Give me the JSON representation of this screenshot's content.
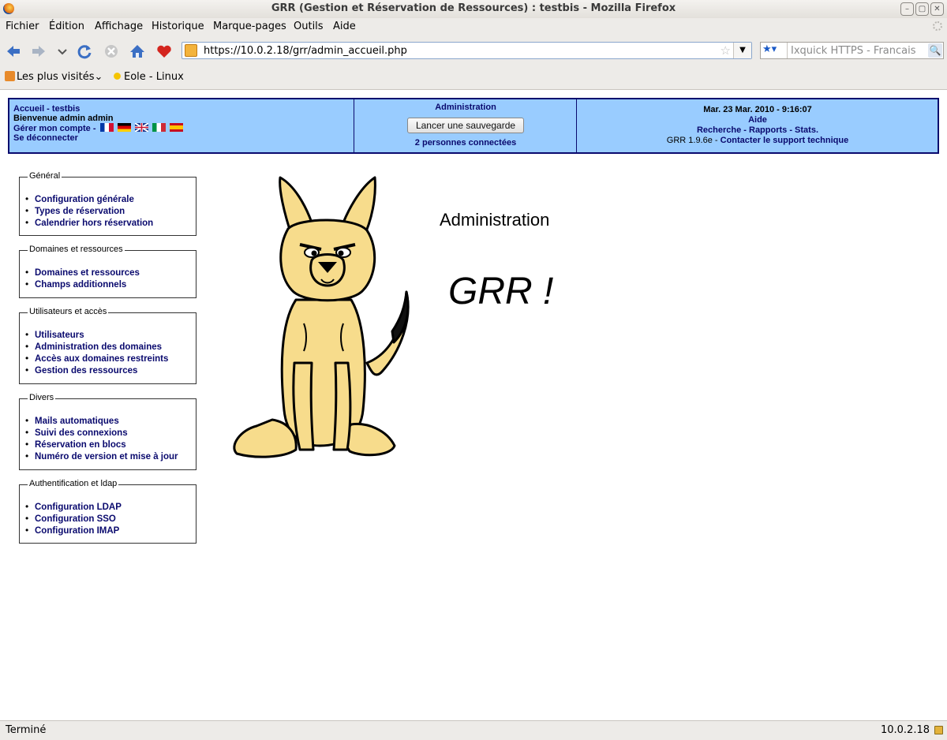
{
  "window": {
    "title": "GRR (Gestion et Réservation de Ressources)  : testbis - Mozilla Firefox"
  },
  "menu": [
    {
      "label": "Fichier",
      "u": "F"
    },
    {
      "label": "Édition",
      "u": ""
    },
    {
      "label": "Affichage",
      "u": "A"
    },
    {
      "label": "Historique",
      "u": "H"
    },
    {
      "label": "Marque-pages",
      "u": "M"
    },
    {
      "label": "Outils",
      "u": "O"
    },
    {
      "label": "Aide",
      "u": "e"
    }
  ],
  "menu_labels": {
    "fichier": "Fichier",
    "edition": "Édition",
    "affichage": "Affichage",
    "historique": "Historique",
    "marquepages": "Marque-pages",
    "outils": "Outils",
    "aide": "Aide"
  },
  "nav": {
    "url": "https://10.0.2.18/grr/admin_accueil.php",
    "search_placeholder": "Ixquick HTTPS - Francais"
  },
  "bookmarks": {
    "most_visited": "Les plus visités",
    "eole": "Eole - Linux"
  },
  "header": {
    "home": "Accueil - testbis",
    "welcome": "Bienvenue admin admin",
    "account": "Gérer mon compte -",
    "logout": "Se déconnecter",
    "admin": "Administration",
    "backup_button": "Lancer une sauvegarde",
    "connected": "2 personnes connectées",
    "date": "Mar. 23 Mar. 2010 - 9:16:07",
    "help": "Aide",
    "search_links": "Recherche - Rapports - Stats.",
    "version": "GRR 1.9.6e",
    "sep": " - ",
    "support": "Contacter le support technique"
  },
  "sections": [
    {
      "legend": "Général",
      "items": [
        "Configuration générale",
        "Types de réservation",
        "Calendrier hors réservation"
      ]
    },
    {
      "legend": "Domaines et ressources",
      "items": [
        "Domaines et ressources",
        "Champs additionnels"
      ]
    },
    {
      "legend": "Utilisateurs et accès",
      "items": [
        "Utilisateurs",
        "Administration des domaines",
        "Accès aux domaines restreints",
        "Gestion des ressources"
      ]
    },
    {
      "legend": "Divers",
      "items": [
        "Mails automatiques",
        "Suivi des connexions",
        "Réservation en blocs",
        "Numéro de version et mise à jour"
      ]
    },
    {
      "legend": "Authentification et ldap",
      "items": [
        "Configuration LDAP",
        "Configuration SSO",
        "Configuration IMAP"
      ]
    }
  ],
  "main": {
    "title": "Administration",
    "logo_text": "GRR !"
  },
  "status": {
    "left": "Terminé",
    "right": "10.0.2.18"
  }
}
